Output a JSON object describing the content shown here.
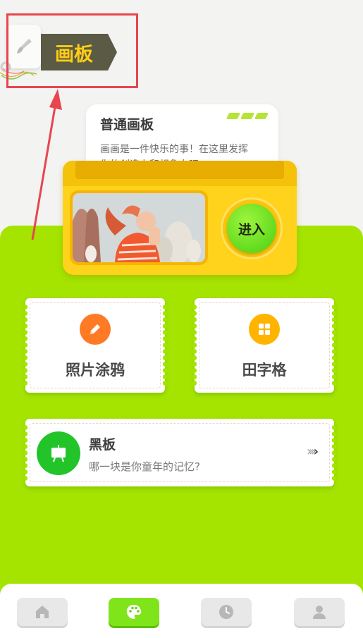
{
  "header": {
    "badge_label": "画板"
  },
  "card": {
    "title": "普通画板",
    "description_line1": "画画是一件快乐的事！在这里发挥",
    "description_line2": "你的创造力和想象力吧～",
    "enter_label": "进入"
  },
  "tools": [
    {
      "label": "照片涂鸦",
      "icon": "pencil-icon"
    },
    {
      "label": "田字格",
      "icon": "grid-icon"
    }
  ],
  "blackboard": {
    "title": "黑板",
    "description": "哪一块是你童年的记忆?",
    "icon": "blackboard-icon"
  },
  "nav": {
    "items": [
      {
        "icon": "home-icon",
        "active": false
      },
      {
        "icon": "palette-icon",
        "active": true
      },
      {
        "icon": "clock-icon",
        "active": false
      },
      {
        "icon": "profile-icon",
        "active": false
      }
    ]
  },
  "colors": {
    "accent_green": "#a4e400",
    "badge_text": "#ffcc16",
    "annotation_red": "#e8454f"
  }
}
